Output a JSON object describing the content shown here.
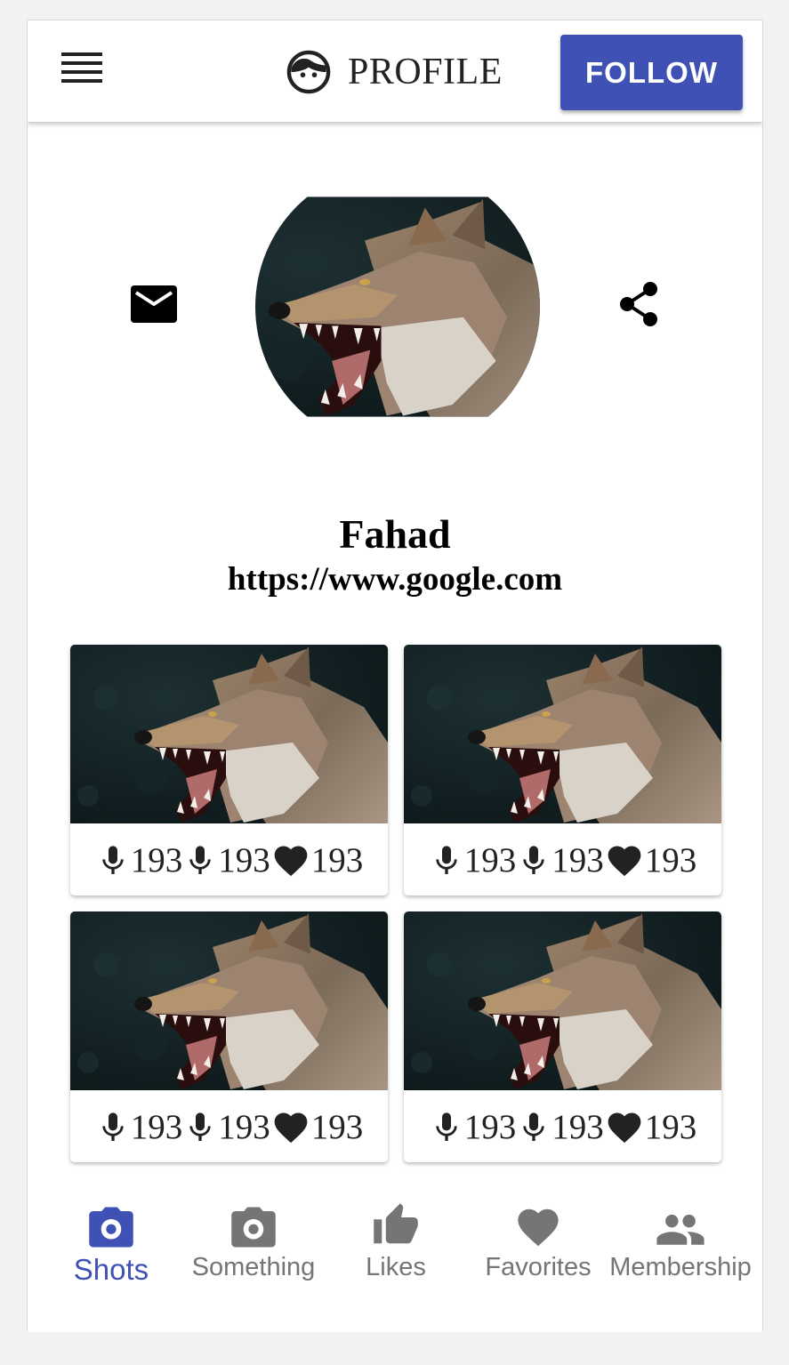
{
  "header": {
    "title": "PROFILE",
    "follow_label": "FOLLOW",
    "accent_color": "#3f51b5"
  },
  "profile": {
    "name": "Fahad",
    "url": "https://www.google.com"
  },
  "icons": {
    "menu": "menu-icon",
    "face": "face-icon",
    "mail": "mail-icon",
    "share": "share-icon",
    "mic": "mic-icon",
    "heart": "heart-icon"
  },
  "shots": [
    {
      "mic1": "193",
      "mic2": "193",
      "likes": "193"
    },
    {
      "mic1": "193",
      "mic2": "193",
      "likes": "193"
    },
    {
      "mic1": "193",
      "mic2": "193",
      "likes": "193"
    },
    {
      "mic1": "193",
      "mic2": "193",
      "likes": "193"
    }
  ],
  "nav": {
    "active": "Shots",
    "items": [
      {
        "label": "Shots",
        "icon": "camera-icon"
      },
      {
        "label": "Something",
        "icon": "camera-icon"
      },
      {
        "label": "Likes",
        "icon": "thumb-up-icon"
      },
      {
        "label": "Favorites",
        "icon": "heart-icon"
      },
      {
        "label": "Membership",
        "icon": "people-icon"
      }
    ]
  }
}
